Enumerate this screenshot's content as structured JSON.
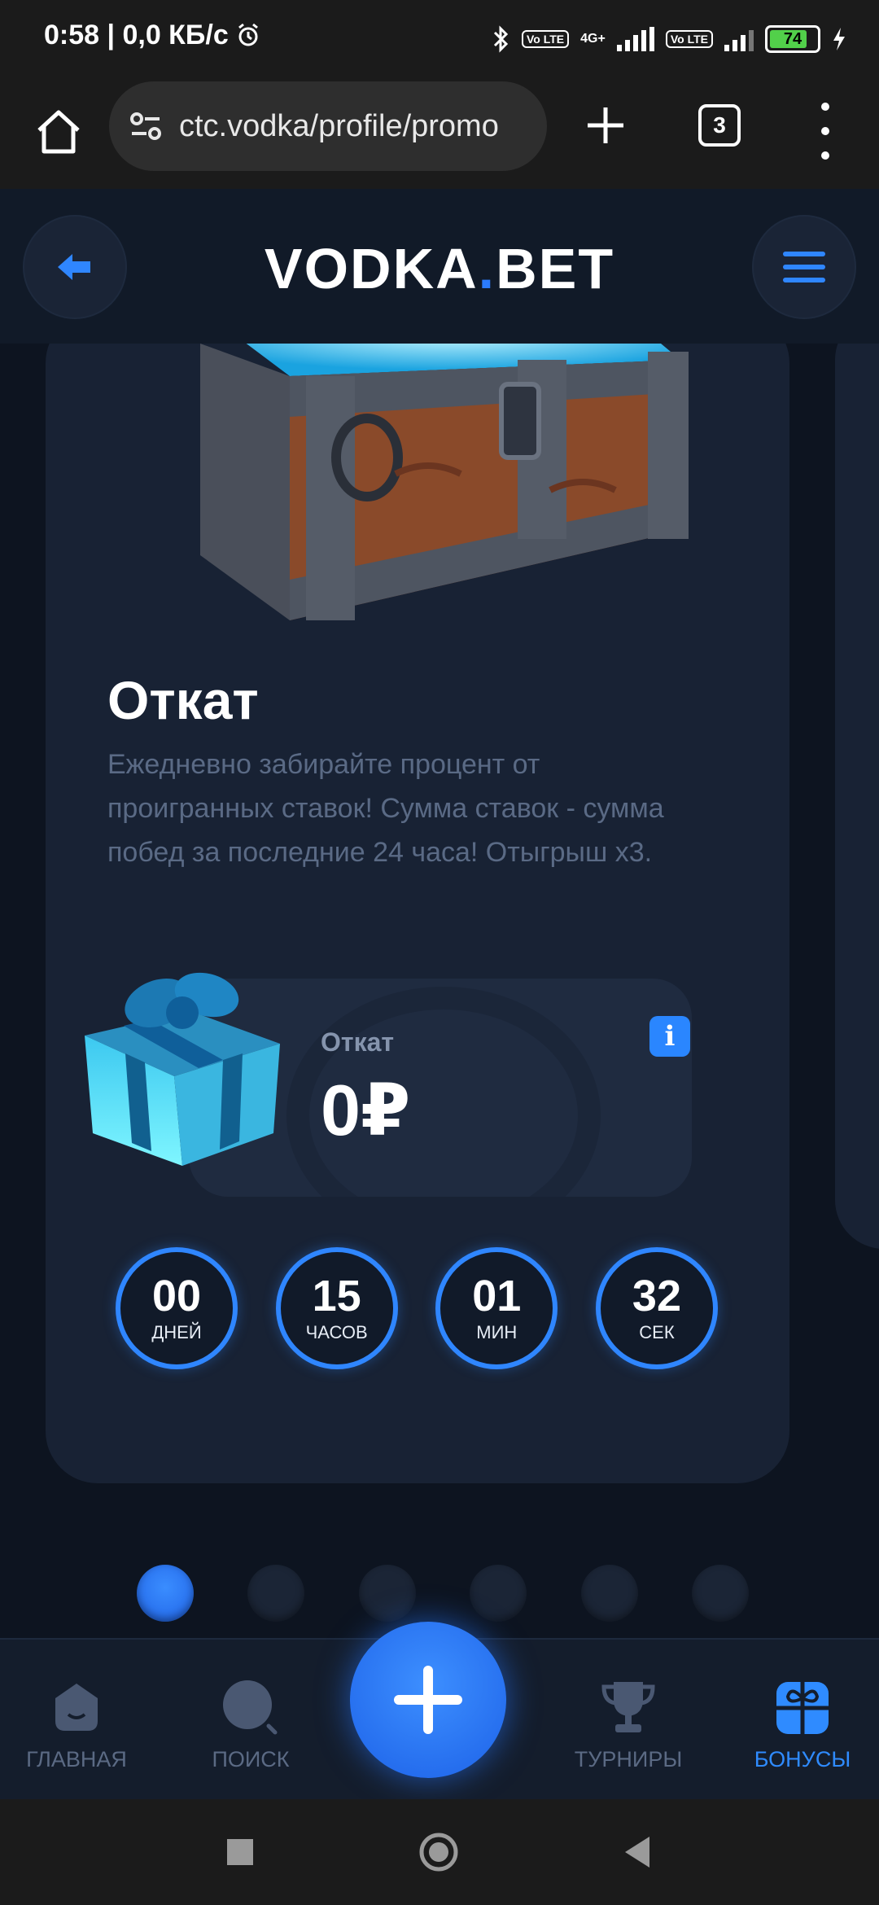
{
  "status_bar": {
    "time": "0:58",
    "speed": "0,0 КБ/с",
    "network": "4G+",
    "volte": "Vo LTE",
    "battery": "74",
    "battery_color": "#52d04a"
  },
  "browser": {
    "url": "ctc.vodka/profile/promo",
    "tab_count": "3"
  },
  "header": {
    "logo_main": "VODKA",
    "logo_dot": ".",
    "logo_tail": "BET"
  },
  "promo": {
    "title": "Откат",
    "description": "Ежедневно забирайте процент от проигранных ставок! Сумма ставок - сумма побед за последние 24 часа! Отыгрыш х3.",
    "cashback_label": "Откат",
    "cashback_value": "0₽",
    "info_label": "i",
    "timer": [
      {
        "value": "00",
        "unit": "ДНЕЙ"
      },
      {
        "value": "15",
        "unit": "ЧАСОВ"
      },
      {
        "value": "01",
        "unit": "МИН"
      },
      {
        "value": "32",
        "unit": "СЕК"
      }
    ]
  },
  "pager": {
    "total": 6,
    "active_index": 0
  },
  "bottom_nav": {
    "items": [
      {
        "label": "ГЛАВНАЯ",
        "icon": "home-icon"
      },
      {
        "label": "ПОИСК",
        "icon": "search-icon"
      },
      {
        "label": "ТУРНИРЫ",
        "icon": "trophy-icon"
      },
      {
        "label": "БОНУСЫ",
        "icon": "gift-icon"
      }
    ],
    "active": "БОНУСЫ"
  },
  "colors": {
    "accent": "#2f86ff",
    "background": "#0d1420",
    "card": "#182234",
    "muted_text": "#5a6a85"
  }
}
